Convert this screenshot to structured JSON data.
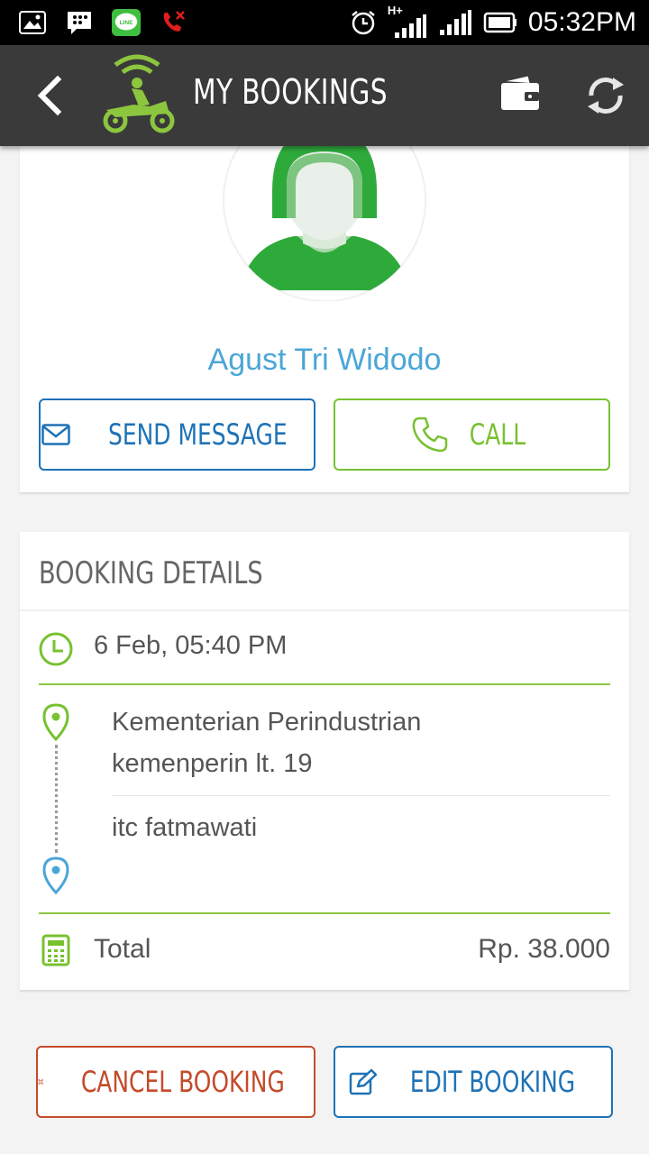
{
  "statusbar": {
    "time": "05:32PM",
    "network": "H+",
    "icons": [
      "gallery-icon",
      "bbm-icon",
      "line-icon",
      "missed-call-icon",
      "alarm-icon",
      "signal-icon",
      "battery-icon"
    ],
    "line_label": "LINE"
  },
  "appbar": {
    "title": "MY BOOKINGS",
    "icons": [
      "back-arrow-icon",
      "gojek-logo",
      "wallet-icon",
      "refresh-icon"
    ]
  },
  "driver": {
    "name": "Agust Tri Widodo",
    "send_message_label": "SEND MESSAGE",
    "call_label": "CALL"
  },
  "booking": {
    "heading": "BOOKING DETAILS",
    "time": "6 Feb, 05:40 PM",
    "pickup_line1": "Kementerian Perindustrian",
    "pickup_line2": "kemenperin lt. 19",
    "destination": "itc fatmawati",
    "total_label": "Total",
    "total_value": "Rp. 38.000"
  },
  "actions": {
    "cancel_label": "CANCEL BOOKING",
    "edit_label": "EDIT BOOKING"
  },
  "colors": {
    "green": "#78c130",
    "blue": "#1e72b6",
    "name_blue": "#4ba6d7",
    "cancel_red": "#c44a2a",
    "appbar": "#3a3a3a"
  }
}
